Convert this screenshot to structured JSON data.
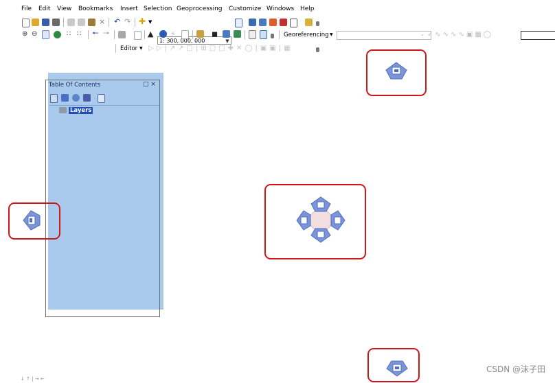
{
  "menu": [
    "File",
    "Edit",
    "View",
    "Bookmarks",
    "Insert",
    "Selection",
    "Geoprocessing",
    "Customize",
    "Windows",
    "Help"
  ],
  "toolbar": {
    "scale_value": "1: 300, 000, 000",
    "georeferencing_label": "Georeferencing",
    "editor_label": "Editor"
  },
  "toc": {
    "title": "Table Of Contents",
    "controls": "□ ×",
    "layers_label": "Layers"
  },
  "watermark": "CSDN @沫子田",
  "statusbar": "↓ ↑ | → ←",
  "colors": {
    "highlight_box": "#d01717",
    "dock_panel": "#a9c9ed",
    "dock_arrow": "#7b95d8",
    "selection": "#1f4eb8"
  },
  "icons": {
    "dock_top": "dock-top-arrow-icon",
    "dock_left": "dock-left-arrow-icon",
    "dock_bottom": "dock-bottom-arrow-icon",
    "dock_center": "dock-compass-icon",
    "layers": "layers-icon"
  }
}
